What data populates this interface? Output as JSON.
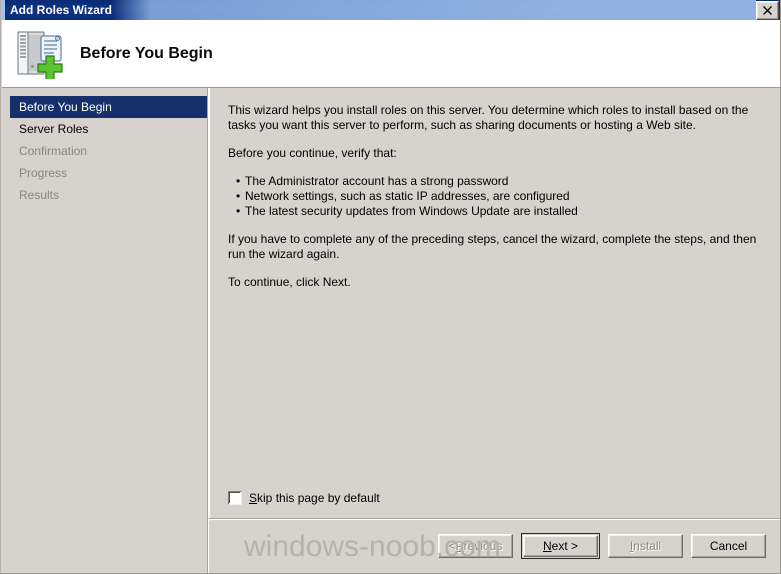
{
  "window": {
    "title": "Add Roles Wizard",
    "close_label": "✕"
  },
  "header": {
    "title": "Before You Begin",
    "icon": "server-add-icon"
  },
  "sidebar": {
    "items": [
      {
        "label": "Before You Begin",
        "state": "selected"
      },
      {
        "label": "Server Roles",
        "state": "enabled"
      },
      {
        "label": "Confirmation",
        "state": "disabled"
      },
      {
        "label": "Progress",
        "state": "disabled"
      },
      {
        "label": "Results",
        "state": "disabled"
      }
    ]
  },
  "content": {
    "intro": "This wizard helps you install roles on this server. You determine which roles to install based on the tasks you want this server to perform, such as sharing documents or hosting a Web site.",
    "verify_heading": "Before you continue, verify that:",
    "bullets": [
      "The Administrator account has a strong password",
      "Network settings, such as static IP addresses, are configured",
      "The latest security updates from Windows Update are installed"
    ],
    "cancel_note": "If you have to complete any of the preceding steps, cancel the wizard, complete the steps, and then run the wizard again.",
    "continue_note": "To continue, click Next."
  },
  "checkbox": {
    "accel": "S",
    "label_rest": "kip this page by default",
    "checked": false
  },
  "buttons": {
    "previous": {
      "prefix": "< ",
      "accel": "P",
      "rest": "revious",
      "enabled": false
    },
    "next": {
      "prefix": "",
      "accel": "N",
      "rest": "ext >",
      "enabled": true,
      "default": true
    },
    "install": {
      "prefix": "",
      "accel": "I",
      "rest": "nstall",
      "enabled": false
    },
    "cancel": {
      "prefix": "",
      "accel": "",
      "rest": "Cancel",
      "enabled": true
    }
  },
  "watermark": {
    "text": "windows-noob.com"
  },
  "colors": {
    "titlebar": "#0e3386",
    "selection": "#15306b",
    "face": "#d6d3ce",
    "header_band": "#ffffff",
    "disabled_text": "#888581",
    "watermark": "#b6b2ab"
  }
}
